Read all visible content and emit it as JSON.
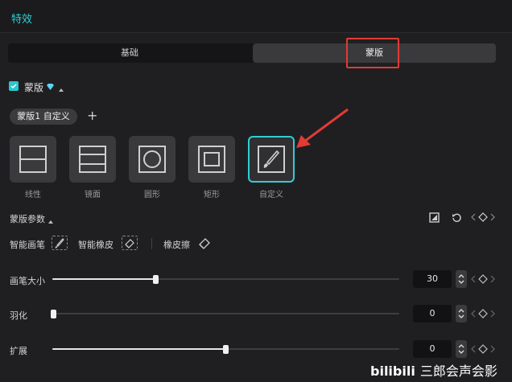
{
  "panel": {
    "title": "特效"
  },
  "tabs": [
    {
      "label": "基础"
    },
    {
      "label": "蒙版"
    }
  ],
  "mask_section": {
    "label": "蒙版",
    "checked": true
  },
  "preset": {
    "label": "蒙版1 自定义",
    "add_symbol": "+"
  },
  "shapes": [
    {
      "label": "线性",
      "icon": "linear-mask-icon"
    },
    {
      "label": "镜面",
      "icon": "mirror-mask-icon"
    },
    {
      "label": "圆形",
      "icon": "circle-mask-icon"
    },
    {
      "label": "矩形",
      "icon": "rect-mask-icon"
    },
    {
      "label": "自定义",
      "icon": "brush-icon",
      "selected": true
    }
  ],
  "params": {
    "label": "蒙版参数",
    "tools": [
      {
        "label": "智能画笔"
      },
      {
        "label": "智能橡皮"
      },
      {
        "label": "橡皮擦"
      }
    ],
    "sliders": [
      {
        "label": "画笔大小",
        "value": "30",
        "level": 0.3
      },
      {
        "label": "羽化",
        "value": "0",
        "level": 0
      },
      {
        "label": "扩展",
        "value": "0",
        "level": 0.5
      }
    ]
  },
  "watermark": {
    "logo": "bilibili",
    "text": "三郎会声会影"
  },
  "colors": {
    "accent": "#2dd0d6",
    "annotation": "#e23a35",
    "background": "#1f1f21"
  }
}
